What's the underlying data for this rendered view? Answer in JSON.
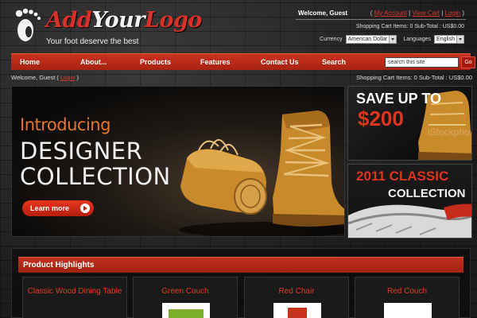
{
  "logo": {
    "brand_part1": "Add",
    "brand_part2": "Your",
    "brand_part3": "Logo",
    "tagline": "Your foot deserve the best"
  },
  "account": {
    "welcome": "Welcome, Guest",
    "links": [
      "My Account",
      "View Cart",
      "Login"
    ],
    "cart_summary": "Shopping Cart Items: 0   Sub-Total : US$0.00",
    "currency_label": "Currency",
    "currency_value": "American Dollar",
    "language_label": "Languages",
    "language_value": "English"
  },
  "nav": {
    "items": [
      "Home",
      "About...",
      "Products",
      "Features",
      "Contact Us",
      "Search"
    ],
    "search_placeholder": "search this site",
    "go_label": "Go"
  },
  "subbar": {
    "welcome_prefix": "Welcome, Guest (",
    "login_link": "Login",
    "welcome_suffix": ")",
    "cart_summary": "Shopping Cart Items: 0   Sub-Total : US$0.00"
  },
  "hero": {
    "intro": "Introducing",
    "line1": "DESIGNER",
    "line2": "COLLECTION",
    "button": "Learn more"
  },
  "promo1": {
    "line1": "SAVE UP TO",
    "line2": "$200",
    "watermark": "iStockpho"
  },
  "promo2": {
    "line1": "2011 CLASSIC",
    "line2": "COLLECTION"
  },
  "highlights": {
    "title": "Product Highlights",
    "products": [
      "Classic Wood Dining Table",
      "Green Couch",
      "Red Chair",
      "Red Couch"
    ]
  },
  "colors": {
    "accent": "#c8321f",
    "background": "#2a2a2a",
    "link": "#d8342c"
  }
}
